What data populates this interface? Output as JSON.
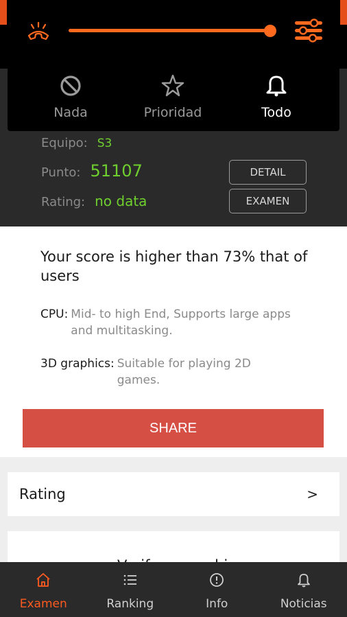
{
  "score": {
    "equipo_label": "Equipo:",
    "equipo_value": "S3",
    "punto_label": "Punto:",
    "punto_value": "51107",
    "rating_label": "Rating:",
    "rating_value": "no data",
    "detail_button": "DETAIL",
    "examen_button": "EXAMEN"
  },
  "quick_settings": {
    "volume_level": 0.97,
    "options": [
      {
        "label": "Nada",
        "icon": "block-icon",
        "active": false
      },
      {
        "label": "Prioridad",
        "icon": "star-icon",
        "active": false
      },
      {
        "label": "Todo",
        "icon": "bell-icon",
        "active": true
      }
    ],
    "accent": "#ff6a1f"
  },
  "summary": {
    "title": "Your score is higher than 73% that of users",
    "cpu_label": "CPU:",
    "cpu_value": "Mid- to high End, Supports large apps and multitasking.",
    "graphics_label": "3D graphics:",
    "graphics_value": "Suitable for playing 2D games.",
    "share_button": "SHARE",
    "share_color": "#d64f45"
  },
  "rating_card": {
    "label": "Rating",
    "chevron": ">"
  },
  "partial_card_text": "Verify ownership",
  "bottom_nav": [
    {
      "label": "Examen",
      "icon": "home-icon",
      "active": true
    },
    {
      "label": "Ranking",
      "icon": "list-icon",
      "active": false
    },
    {
      "label": "Info",
      "icon": "info-icon",
      "active": false
    },
    {
      "label": "Noticias",
      "icon": "bell-icon",
      "active": false
    }
  ],
  "colors": {
    "active_nav": "#ff5a1f",
    "score_green": "#6fcf2f",
    "dark_bg": "#2a2a2a"
  }
}
